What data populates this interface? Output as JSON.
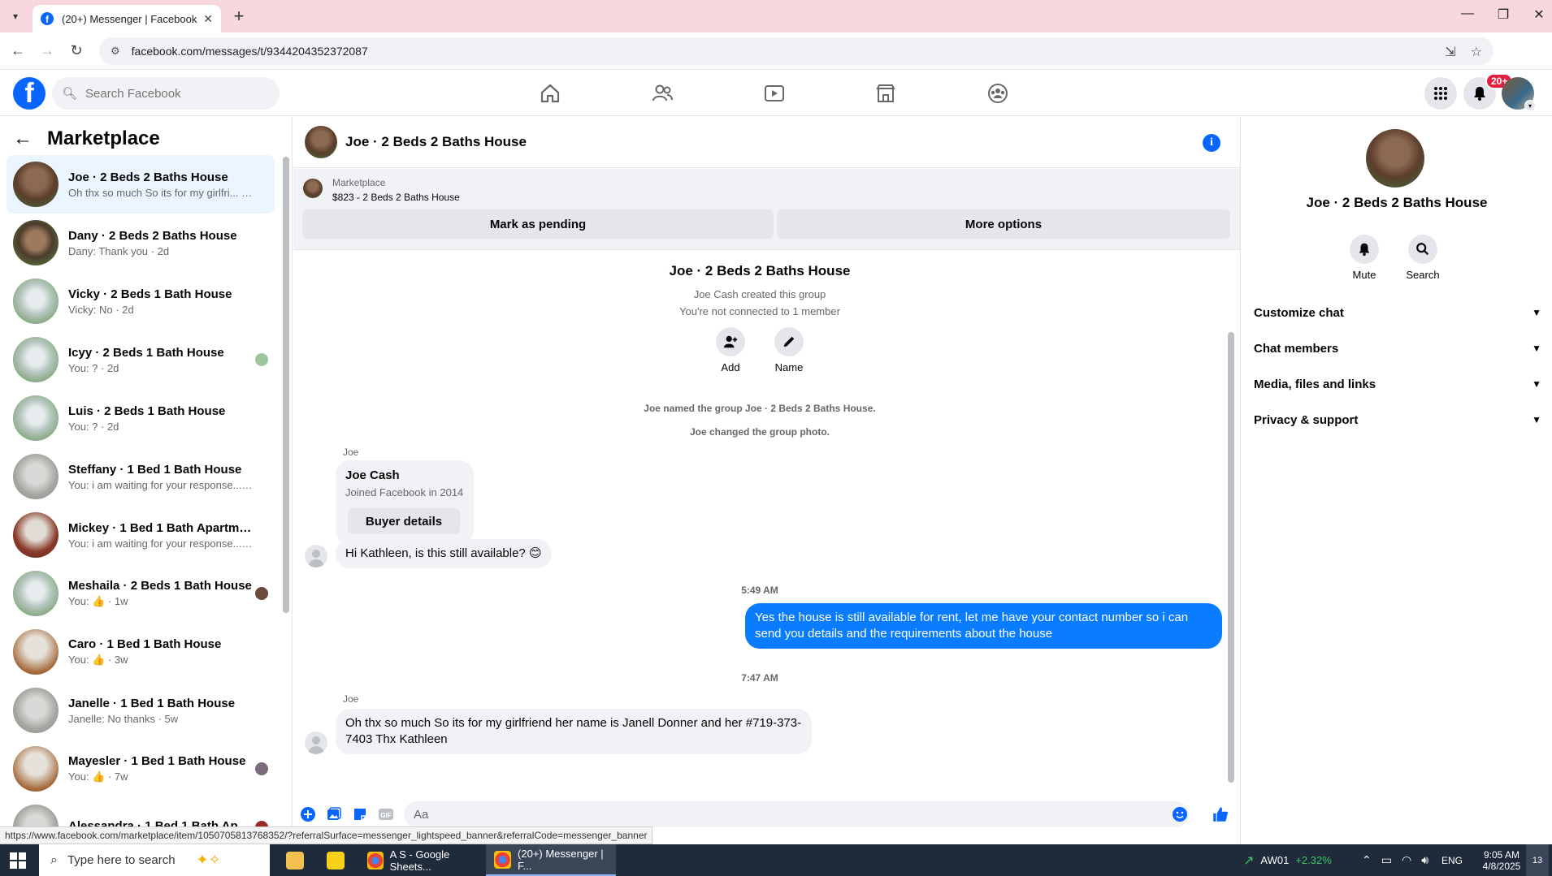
{
  "browser": {
    "tab_title": "(20+) Messenger | Facebook",
    "url": "facebook.com/messages/t/9344204352372087"
  },
  "fb": {
    "search_placeholder": "Search Facebook",
    "notif_count": "20+"
  },
  "left": {
    "title": "Marketplace",
    "chats": [
      {
        "name": "Joe · 2 Beds 2 Baths House",
        "preview": "Oh thx so much So its for my girlfri... · 1h",
        "avatar": "av-brick",
        "active": true
      },
      {
        "name": "Dany · 2 Beds 2 Baths House",
        "preview": "Dany: Thank you · 2d",
        "avatar": "av-tudor"
      },
      {
        "name": "Vicky · 2 Beds 1 Bath House",
        "preview": "Vicky: No · 2d",
        "avatar": "av-white"
      },
      {
        "name": "Icyy · 2 Beds 1 Bath House",
        "preview": "You: ? · 2d",
        "avatar": "av-white",
        "dot": "#9fc5a0"
      },
      {
        "name": "Luis · 2 Beds 1 Bath House",
        "preview": "You: ? · 2d",
        "avatar": "av-white"
      },
      {
        "name": "Steffany · 1 Bed 1 Bath House",
        "preview": "You: i am waiting for your response... · 4d",
        "avatar": "av-room"
      },
      {
        "name": "Mickey · 1 Bed 1 Bath Apartment...",
        "preview": "You: i am waiting for your response... · 4d",
        "avatar": "av-red"
      },
      {
        "name": "Meshaila · 2 Beds 1 Bath House",
        "preview": "You: 👍 · 1w",
        "avatar": "av-white",
        "dot": "#6a4a3a"
      },
      {
        "name": "Caro · 1 Bed 1 Bath House",
        "preview": "You: 👍 · 3w",
        "avatar": "av-wood"
      },
      {
        "name": "Janelle · 1 Bed 1 Bath House",
        "preview": "Janelle: No thanks · 5w",
        "avatar": "av-room"
      },
      {
        "name": "Mayesler · 1 Bed 1 Bath House",
        "preview": "You: 👍 · 7w",
        "avatar": "av-wood",
        "dot": "#7a6a7a"
      },
      {
        "name": "Alessandra · 1 Bed 1 Bath Apar...",
        "preview": "",
        "avatar": "av-room",
        "dot": "#9a2a2a"
      }
    ]
  },
  "center": {
    "header_title": "Joe · 2 Beds 2 Baths House",
    "banner_label": "Marketplace",
    "banner_price": "$823 - 2 Beds 2 Baths House",
    "btn_pending": "Mark as pending",
    "btn_more": "More options",
    "group_name": "Joe · 2 Beds 2 Baths House",
    "created": "Joe Cash created this group",
    "not_connected": "You're not connected to 1 member",
    "add_label": "Add",
    "name_label": "Name",
    "sys1": "Joe named the group Joe · 2 Beds 2 Baths House.",
    "sys2": "Joe changed the group photo.",
    "sender1": "Joe",
    "card_name": "Joe Cash",
    "card_sub": "Joined Facebook in 2014",
    "card_btn": "Buyer details",
    "msg1": "Hi Kathleen, is this still available? 😊",
    "time1": "5:49 AM",
    "msg_out": "Yes the house is still available for rent, let me have your contact number so i can send you details and the requirements about the house",
    "time2": "7:47 AM",
    "sender2": "Joe",
    "msg2": "Oh thx so much So its for my girlfriend her name is Janell Donner and her #719-373-7403 Thx Kathleen",
    "composer_placeholder": "Aa"
  },
  "right": {
    "name": "Joe · 2 Beds 2 Baths House",
    "mute": "Mute",
    "search": "Search",
    "rows": [
      "Customize chat",
      "Chat members",
      "Media, files and links",
      "Privacy & support"
    ]
  },
  "status_url": "https://www.facebook.com/marketplace/item/1050705813768352/?referralSurface=messenger_lightspeed_banner&referralCode=messenger_banner",
  "taskbar": {
    "search_placeholder": "Type here to search",
    "app1": "A S - Google Sheets...",
    "app2": "(20+) Messenger | F...",
    "stock_name": "AW01",
    "stock_change": "+2.32%",
    "lang": "ENG",
    "time": "9:05 AM",
    "date": "4/8/2025",
    "notif": "13"
  },
  "colors": {
    "accent": "#0866ff",
    "bubble_out": "#0a7cff",
    "tab_bg": "#f8d7de"
  }
}
